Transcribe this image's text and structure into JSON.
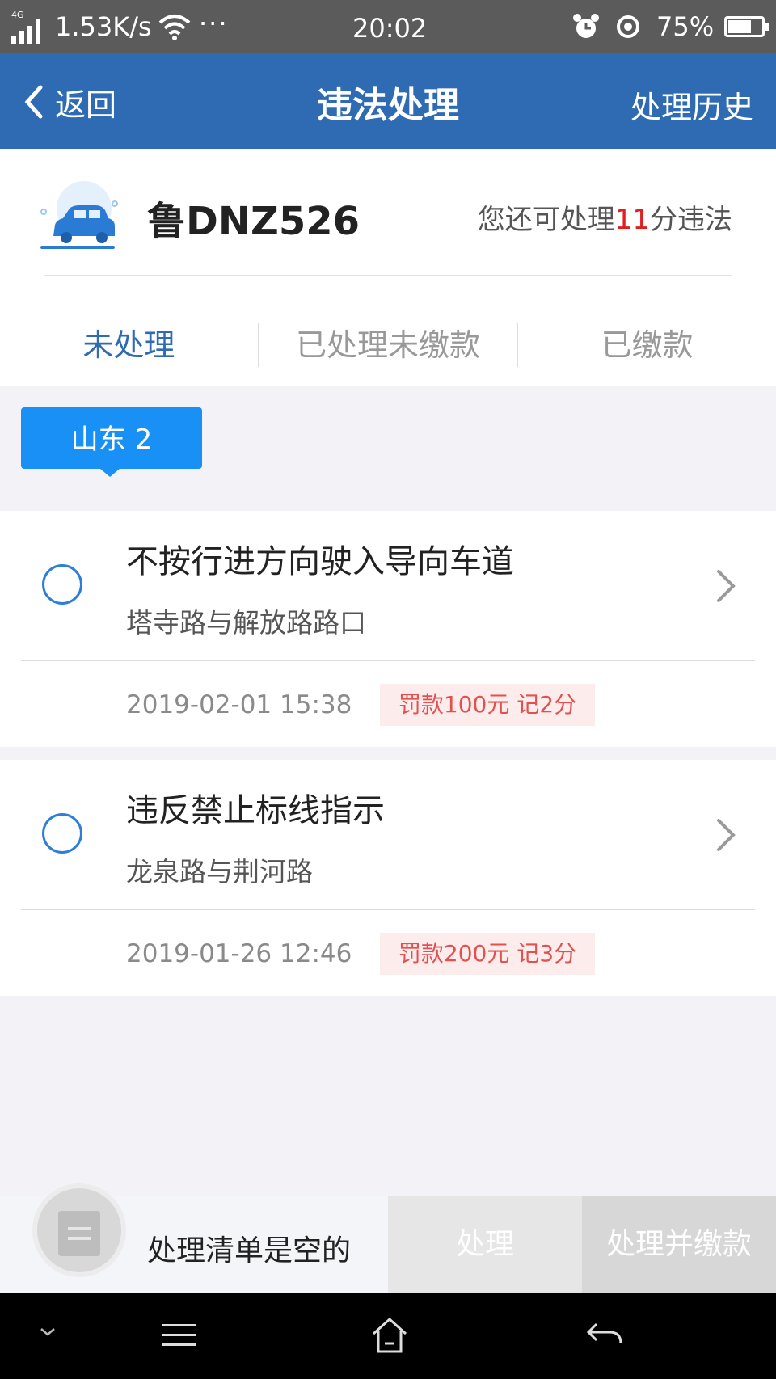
{
  "status_bar": {
    "network": "4G",
    "speed": "1.53K/s",
    "more": "···",
    "time": "20:02",
    "battery_pct": "75%"
  },
  "nav": {
    "back_label": "返回",
    "title": "违法处理",
    "history_label": "处理历史"
  },
  "vehicle": {
    "plate": "鲁DNZ526",
    "quota_prefix": "您还可处理",
    "quota_points": "11",
    "quota_suffix": "分违法"
  },
  "tabs": [
    {
      "label": "未处理",
      "active": true
    },
    {
      "label": "已处理未缴款",
      "active": false
    },
    {
      "label": "已缴款",
      "active": false
    }
  ],
  "region_tag": "山东 2",
  "violations": [
    {
      "title": "不按行进方向驶入导向车道",
      "place": "塔寺路与解放路路口",
      "datetime": "2019-02-01 15:38",
      "penalty": "罚款100元 记2分"
    },
    {
      "title": "违反禁止标线指示",
      "place": "龙泉路与荆河路",
      "datetime": "2019-01-26 12:46",
      "penalty": "罚款200元 记3分"
    }
  ],
  "action_bar": {
    "empty_text": "处理清单是空的",
    "process_label": "处理",
    "process_pay_label": "处理并缴款"
  },
  "colors": {
    "brand_blue": "#2e6bb2",
    "tag_blue": "#1890f5",
    "points_red": "#e02020",
    "penalty_bg": "#fdecec"
  }
}
